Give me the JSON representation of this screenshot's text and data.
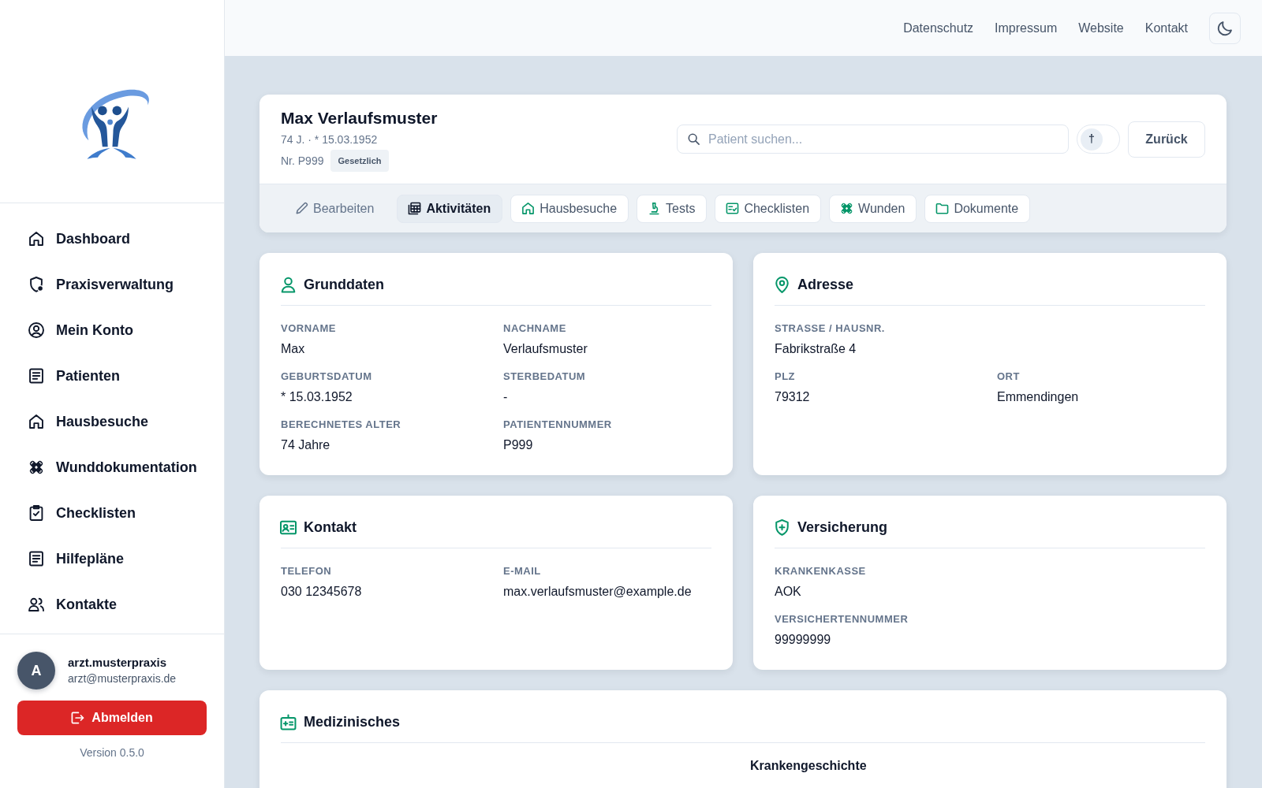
{
  "topbar": {
    "links": [
      "Datenschutz",
      "Impressum",
      "Website",
      "Kontakt"
    ]
  },
  "sidebar": {
    "items": [
      {
        "label": "Dashboard",
        "selected": false
      },
      {
        "label": "Praxisverwaltung",
        "selected": false
      },
      {
        "label": "Mein Konto",
        "selected": false
      },
      {
        "label": "Patienten",
        "selected": false
      },
      {
        "label": "Hausbesuche",
        "selected": false
      },
      {
        "label": "Wunddokumentation",
        "selected": false
      },
      {
        "label": "Checklisten",
        "selected": false
      },
      {
        "label": "Hilfepläne",
        "selected": false
      },
      {
        "label": "Kontakte",
        "selected": false
      }
    ],
    "user": {
      "initial": "A",
      "username": "arzt.musterpraxis",
      "email": "arzt@musterpraxis.de"
    },
    "logout_button": "Abmelden",
    "version": "Version 0.5.0"
  },
  "patient_header": {
    "name": "Max Verlaufsmuster",
    "age_birth": "74 J. · * 15.03.1952",
    "number": "Nr. P999",
    "insurance_badge": "Gesetzlich",
    "search": {
      "placeholder": "Patient suchen..."
    },
    "deceased_toggle": {
      "symbol": "†",
      "on": false
    },
    "back_button": "Zurück",
    "tabs": [
      {
        "label": "Bearbeiten",
        "kind": "action",
        "selected": false
      },
      {
        "label": "Aktivitäten",
        "kind": "tab",
        "selected": true
      },
      {
        "label": "Hausbesuche",
        "kind": "tab",
        "selected": false
      },
      {
        "label": "Tests",
        "kind": "tab",
        "selected": false
      },
      {
        "label": "Checklisten",
        "kind": "tab",
        "selected": false
      },
      {
        "label": "Wunden",
        "kind": "tab",
        "selected": false
      },
      {
        "label": "Dokumente",
        "kind": "tab",
        "selected": false
      }
    ]
  },
  "cards": [
    {
      "title": "Grunddaten",
      "rows": [
        [
          {
            "label": "VORNAME",
            "value": "Max"
          },
          {
            "label": "NACHNAME",
            "value": "Verlaufsmuster"
          }
        ],
        [
          {
            "label": "GEBURTSDATUM",
            "value": "* 15.03.1952"
          },
          {
            "label": "STERBEDATUM",
            "value": "-"
          }
        ],
        [
          {
            "label": "BERECHNETES ALTER",
            "value": "74 Jahre"
          },
          {
            "label": "PATIENTENNUMMER",
            "value": "P999"
          }
        ]
      ]
    },
    {
      "title": "Adresse",
      "rows": [
        [
          {
            "label": "STRASSE / HAUSNR.",
            "value": "Fabrikstraße 4"
          }
        ],
        [
          {
            "label": "PLZ",
            "value": "79312"
          },
          {
            "label": "ORT",
            "value": "Emmendingen"
          }
        ]
      ]
    },
    {
      "title": "Kontakt",
      "rows": [
        [
          {
            "label": "TELEFON",
            "value": "030 12345678"
          },
          {
            "label": "E-MAIL",
            "value": "max.verlaufsmuster@example.de"
          }
        ]
      ]
    },
    {
      "title": "Versicherung",
      "rows": [
        [
          {
            "label": "KRANKENKASSE",
            "value": "AOK"
          }
        ],
        [
          {
            "label": "VERSICHERTENNUMMER",
            "value": "99999999"
          }
        ]
      ]
    }
  ],
  "medical_card": {
    "title": "Medizinisches",
    "subheading": "Krankengeschichte"
  }
}
